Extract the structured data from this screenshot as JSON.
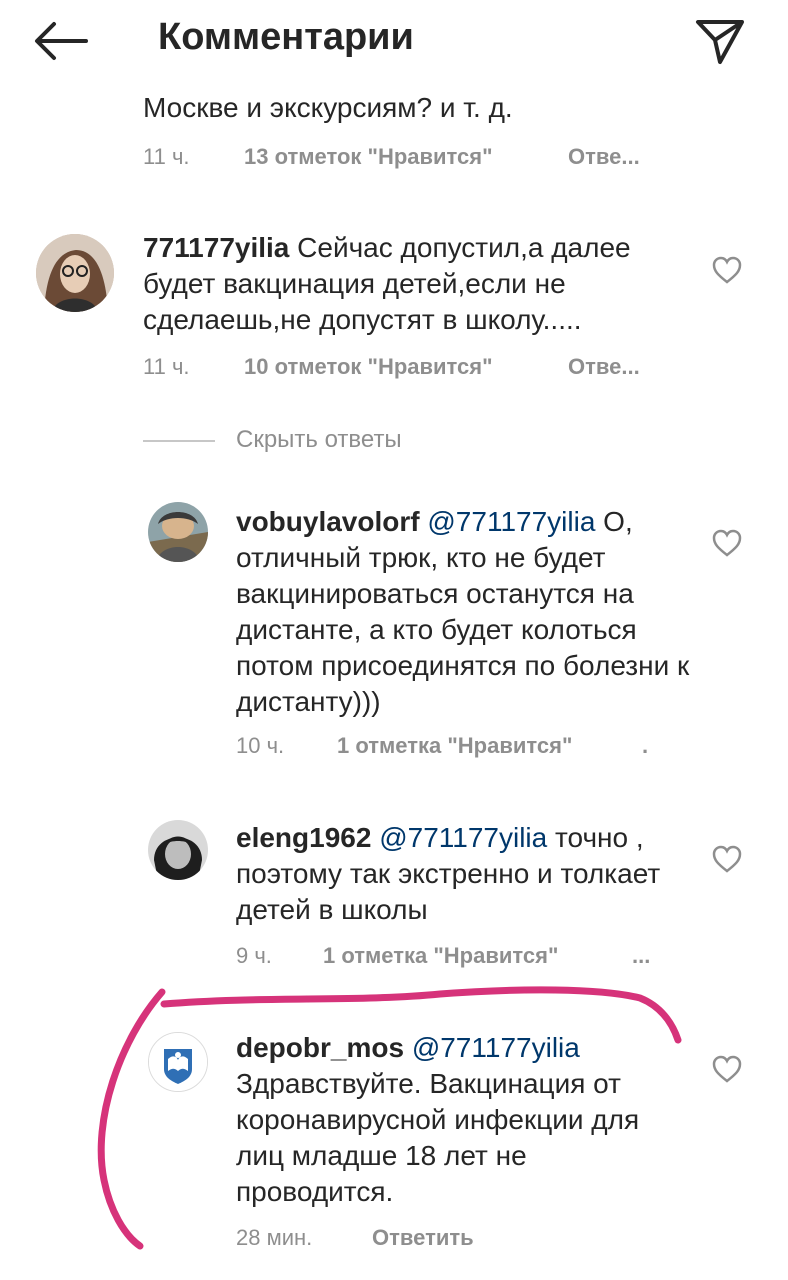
{
  "header": {
    "title": "Комментарии"
  },
  "comments": [
    {
      "text_tail": "Москве и экскурсиям? и т. д.",
      "time": "11 ч.",
      "likes": "13 отметок \"Нравится\"",
      "reply": "Отве..."
    },
    {
      "username": "771177yilia",
      "text": "Сейчас допустил,а далее будет вакцинация детей,если не сделаешь,не допустят в школу.....",
      "time": "11 ч.",
      "likes": "10 отметок \"Нравится\"",
      "reply": "Отве...",
      "hide_replies": "Скрыть ответы"
    },
    {
      "username": "vobuylavolorf",
      "mention": "@771177yilia",
      "text": "О, отличный трюк, кто не будет вакцинироваться останутся на дистанте, а кто будет колоться потом присоединятся по болезни к дистанту)))",
      "time": "10 ч.",
      "likes": "1 отметка \"Нравится\"",
      "reply": "."
    },
    {
      "username": "eleng1962",
      "mention": "@771177yilia",
      "text": "точно , поэтому так экстренно и толкает детей в школы",
      "time": "9 ч.",
      "likes": "1 отметка \"Нравится\"",
      "reply": "..."
    },
    {
      "username": "depobr_mos",
      "mention": "@771177yilia",
      "text": "Здравствуйте. Вакцинация от коронавирусной инфекции для лиц младше 18 лет не проводится.",
      "time": "28 мин.",
      "reply": "Ответить"
    }
  ],
  "icons": [
    "back-arrow-icon",
    "send-icon",
    "heart-icon"
  ],
  "colors": {
    "mention": "#00376b",
    "meta": "#8e8e8e",
    "annotation": "#d6337a"
  }
}
